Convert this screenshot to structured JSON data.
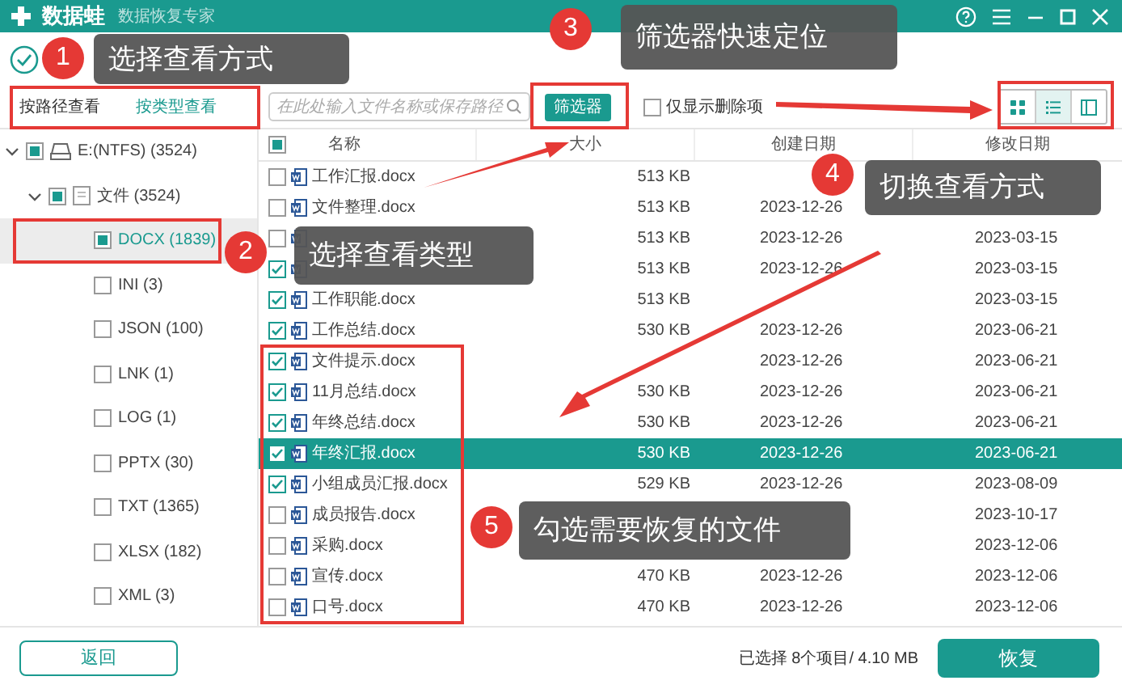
{
  "window": {
    "title": "数据蛙",
    "subtitle": "数据恢复专家"
  },
  "view_tabs": [
    {
      "label": "按路径查看",
      "selected": false
    },
    {
      "label": "按类型查看",
      "selected": true
    }
  ],
  "search": {
    "placeholder": "在此处输入文件名称或保存路径"
  },
  "filter_button": "筛选器",
  "deleted_only": {
    "label": "仅显示删除项",
    "checked": false
  },
  "view_modes": [
    {
      "kind": "grid",
      "selected": false
    },
    {
      "kind": "list",
      "selected": true
    },
    {
      "kind": "detail",
      "selected": false
    }
  ],
  "tree": [
    {
      "label": "E:(NTFS) (3524)",
      "kind": "drive",
      "checked": false,
      "partial": true,
      "expanded": true,
      "selected": false,
      "children": [
        {
          "label": "文件 (3524)",
          "kind": "folder",
          "checked": false,
          "partial": true,
          "expanded": true,
          "selected": false,
          "children": [
            {
              "label": "DOCX (1839)",
              "checked": false,
              "partial": true,
              "selected": true
            },
            {
              "label": "INI (3)",
              "checked": false,
              "partial": false,
              "selected": false
            },
            {
              "label": "JSON (100)",
              "checked": false,
              "partial": false,
              "selected": false
            },
            {
              "label": "LNK (1)",
              "checked": false,
              "partial": false,
              "selected": false
            },
            {
              "label": "LOG (1)",
              "checked": false,
              "partial": false,
              "selected": false
            },
            {
              "label": "PPTX (30)",
              "checked": false,
              "partial": false,
              "selected": false
            },
            {
              "label": "TXT (1365)",
              "checked": false,
              "partial": false,
              "selected": false
            },
            {
              "label": "XLSX (182)",
              "checked": false,
              "partial": false,
              "selected": false
            },
            {
              "label": "XML (3)",
              "checked": false,
              "partial": false,
              "selected": false
            }
          ]
        }
      ]
    }
  ],
  "table": {
    "header_checkbox": {
      "checked": false,
      "partial": true
    },
    "columns": [
      "名称",
      "大小",
      "创建日期",
      "修改日期"
    ],
    "rows": [
      {
        "name": "工作汇报.docx",
        "size": "513 KB",
        "checked": false,
        "selected": false
      },
      {
        "name": "文件整理.docx",
        "size": "513 KB",
        "created": "2023-12-26",
        "checked": false,
        "selected": false
      },
      {
        "size": "513 KB",
        "created": "2023-12-26",
        "modified": "2023-03-15",
        "checked": false,
        "selected": false
      },
      {
        "size": "513 KB",
        "created": "2023-12-26",
        "modified": "2023-03-15",
        "checked": true,
        "selected": false
      },
      {
        "name": "工作职能.docx",
        "size": "513 KB",
        "modified": "2023-03-15",
        "checked": true,
        "selected": false
      },
      {
        "name": "工作总结.docx",
        "size": "530 KB",
        "created": "2023-12-26",
        "modified": "2023-06-21",
        "checked": true,
        "selected": false
      },
      {
        "name": "文件提示.docx",
        "created": "2023-12-26",
        "modified": "2023-06-21",
        "checked": true,
        "selected": false
      },
      {
        "name": "11月总结.docx",
        "size": "530 KB",
        "created": "2023-12-26",
        "modified": "2023-06-21",
        "checked": true,
        "selected": false
      },
      {
        "name": "年终总结.docx",
        "size": "530 KB",
        "created": "2023-12-26",
        "modified": "2023-06-21",
        "checked": true,
        "selected": false
      },
      {
        "name": "年终汇报.docx",
        "size": "530 KB",
        "created": "2023-12-26",
        "modified": "2023-06-21",
        "checked": true,
        "selected": true
      },
      {
        "name": "小组成员汇报.docx",
        "size": "529 KB",
        "created": "2023-12-26",
        "modified": "2023-08-09",
        "checked": true,
        "selected": false
      },
      {
        "name": "成员报告.docx",
        "modified": "2023-10-17",
        "checked": false,
        "selected": false
      },
      {
        "name": "采购.docx",
        "modified": "2023-12-06",
        "checked": false,
        "selected": false
      },
      {
        "name": "宣传.docx",
        "size": "470 KB",
        "created": "2023-12-26",
        "modified": "2023-12-06",
        "checked": false,
        "selected": false
      },
      {
        "name": "口号.docx",
        "size": "470 KB",
        "created": "2023-12-26",
        "modified": "2023-12-06",
        "checked": false,
        "selected": false
      }
    ]
  },
  "footer": {
    "back_button": "返回",
    "selection_summary": "已选择 8个项目/ 4.10 MB",
    "recover_button": "恢复"
  },
  "callouts": [
    {
      "number": "1",
      "text": "选择查看方式"
    },
    {
      "number": "2",
      "text": "选择查看类型"
    },
    {
      "number": "3",
      "text": "筛选器快速定位"
    },
    {
      "number": "4",
      "text": "切换查看方式"
    },
    {
      "number": "5",
      "text": "勾选需要恢复的文件"
    }
  ]
}
